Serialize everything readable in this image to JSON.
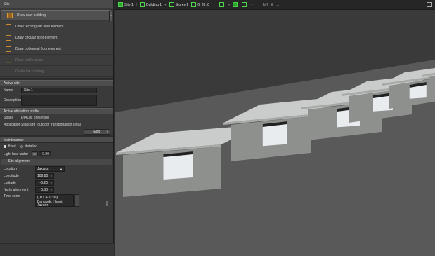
{
  "panel": {
    "title": "Site",
    "tools": [
      {
        "label": "Draw new building",
        "enabled": true
      },
      {
        "label": "Draw rectangular floor element",
        "enabled": true
      },
      {
        "label": "Draw circular floor element",
        "enabled": true
      },
      {
        "label": "Draw polygonal floor element",
        "enabled": true
      },
      {
        "label": "Draw traffic areas",
        "enabled": false
      },
      {
        "label": "Guide the building",
        "enabled": false
      }
    ],
    "active_site": {
      "heading": "Active site",
      "name_label": "Name",
      "name_value": "Site 1",
      "description_label": "Description",
      "description_value": ""
    },
    "utilisation": {
      "heading": "Active utilisation profile",
      "space_label": "Space",
      "space_value": "DIALux presetting",
      "application_label": "Application",
      "application_value": "Standard (outdoor transportation area)",
      "edit_label": "Edit"
    },
    "maintenance": {
      "heading": "Maintenance",
      "fixed_label": "fixed",
      "detailed_label": "detailed",
      "light_loss_label": "Light loss factor",
      "mf_label": "MF",
      "mf_value": "0.80"
    },
    "site_alignment": {
      "heading": "Site alignment",
      "location_label": "Location",
      "location_value": "Jakarta",
      "longitude_label": "Longitude",
      "longitude_value": "106.80",
      "latitude_label": "Latitude",
      "latitude_value": "-6.20",
      "north_label": "North alignment",
      "north_value": "0.00",
      "timezone_label": "Time zone",
      "timezone_value": "(UTC+07:00) Bangkok, Hanoi, Jakarta"
    }
  },
  "toolbar": {
    "site": "Site 1",
    "building": "Building 1",
    "storey": "Storey 1",
    "level": "0, 20, 0"
  },
  "colors": {
    "accent_orange": "#c98a2c",
    "toolbar_green": "#2aa62a",
    "roof": "#c9ccca",
    "wall_front": "#8e908e",
    "wall_side": "#7a7c7a",
    "ground": "#5a5a5a"
  },
  "scene": {
    "building_count": 7
  }
}
